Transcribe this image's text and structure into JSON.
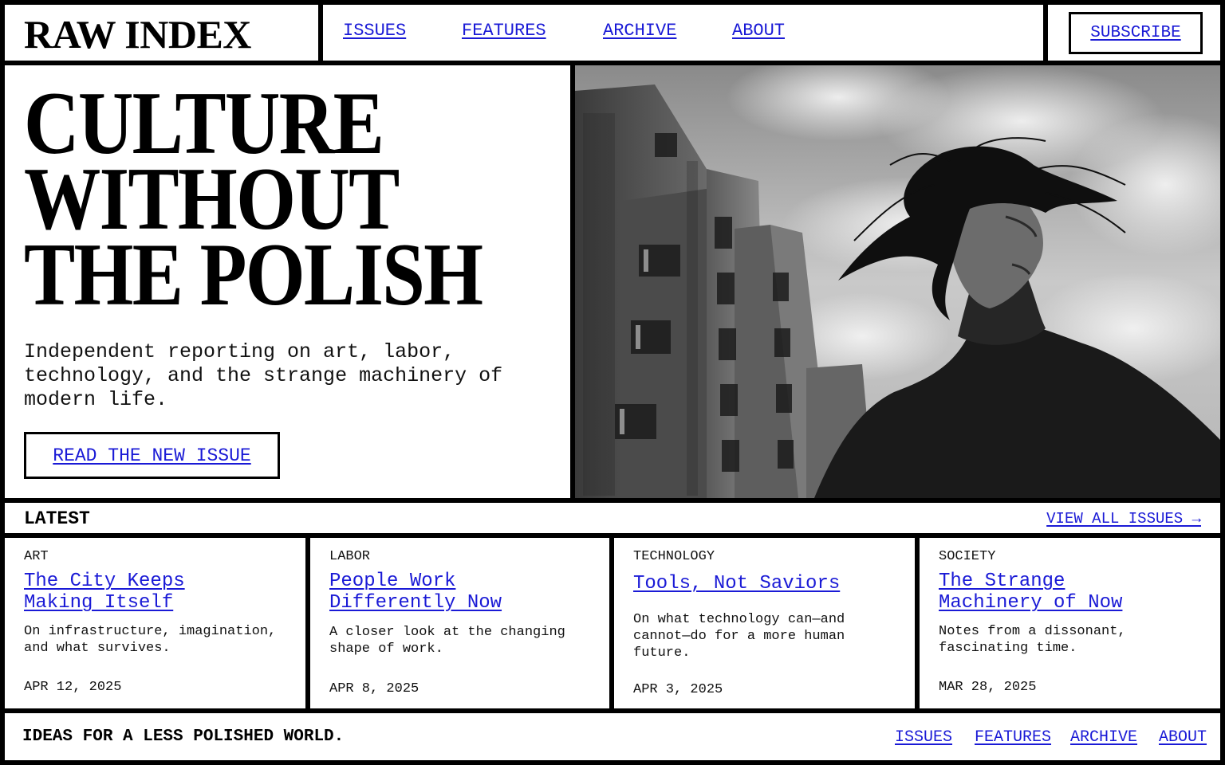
{
  "brand": {
    "name": "RAW INDEX"
  },
  "nav": {
    "items": [
      "ISSUES",
      "FEATURES",
      "ARCHIVE",
      "ABOUT"
    ]
  },
  "subscribe": {
    "label": "SUBSCRIBE"
  },
  "hero": {
    "headline": [
      "CULTURE",
      "WITHOUT",
      "THE POLISH"
    ],
    "intro": "Independent reporting on art, labor, technology, and the strange machinery of modern life.",
    "cta": "READ THE NEW ISSUE"
  },
  "latest": {
    "title": "LATEST",
    "view_all": "VIEW ALL ISSUES →"
  },
  "articles": [
    {
      "category": "ART",
      "title": "The City Keeps Making Itself",
      "description": "On infrastructure, imagination, and what survives.",
      "date": "APR 12, 2025"
    },
    {
      "category": "LABOR",
      "title": "People Work Differently Now",
      "description": "A closer look at the changing shape of work.",
      "date": "APR 8, 2025"
    },
    {
      "category": "TECHNOLOGY",
      "title": "Tools, Not Saviors",
      "description": "On what technology can—and cannot—do for a more human future.",
      "date": "APR 3, 2025"
    },
    {
      "category": "SOCIETY",
      "title": "The Strange Machinery of Now",
      "description": "Notes from a dissonant, fascinating time.",
      "date": "MAR 28, 2025"
    }
  ],
  "footer": {
    "tagline": "IDEAS FOR A LESS POLISHED WORLD.",
    "links": [
      "ISSUES",
      "FEATURES",
      "ARCHIVE",
      "ABOUT"
    ]
  },
  "colors": {
    "link": "#1a1ad6",
    "ink": "#000000",
    "paper": "#ffffff"
  }
}
